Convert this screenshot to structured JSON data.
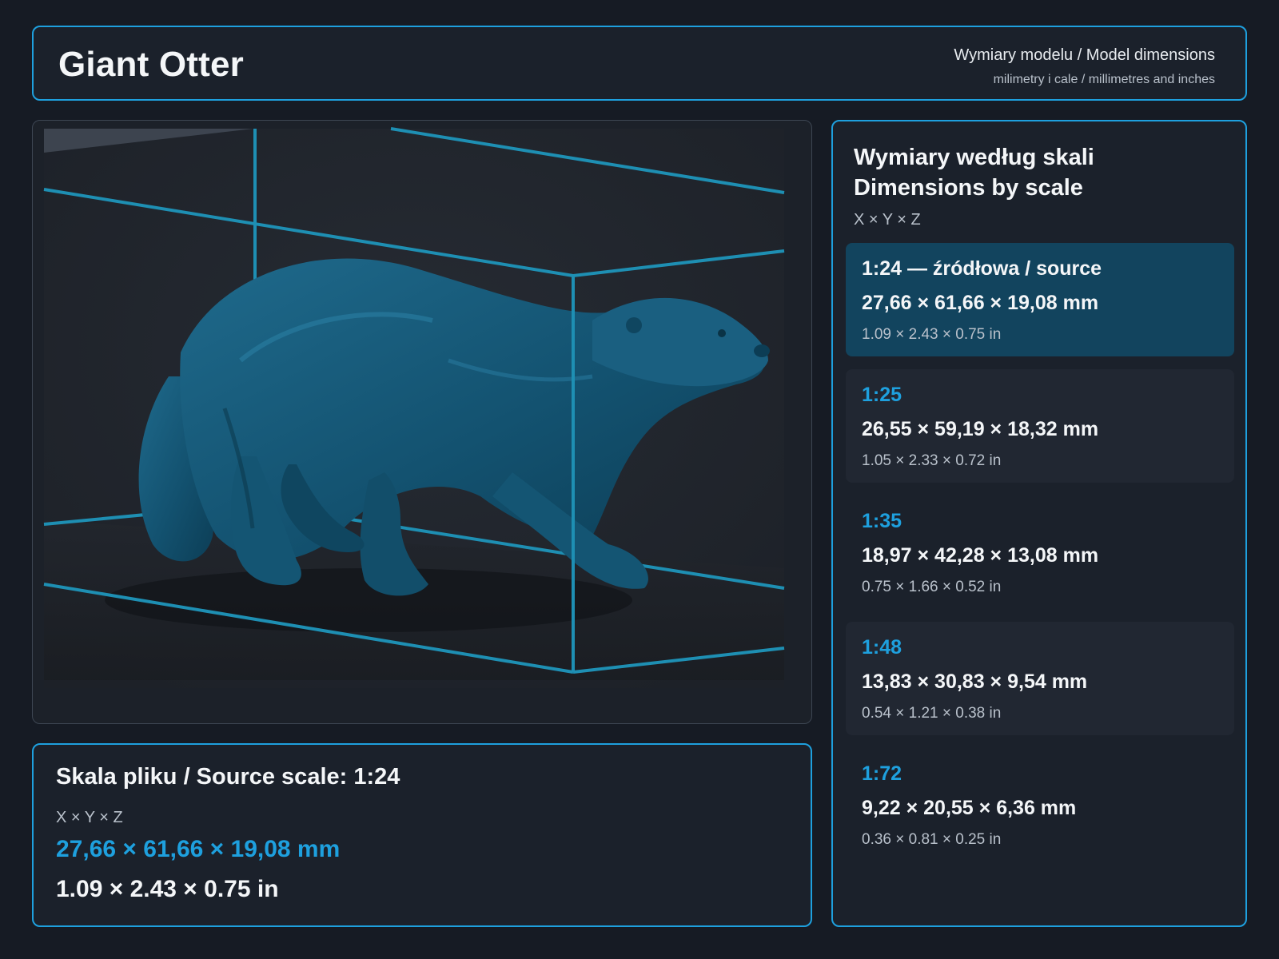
{
  "header": {
    "title": "Giant Otter",
    "subtitle": "Wymiary modelu / Model dimensions",
    "units_note": "milimetry i cale / millimetres and inches"
  },
  "viewer": {
    "model_icon": "otter-render",
    "model_color": "#135270",
    "box_color": "#1e8fb3"
  },
  "source": {
    "title": "Skala pliku / Source scale: 1:24",
    "axis_label": "X × Y × Z",
    "mm": "27,66 × 61,66 × 19,08 mm",
    "inches": "1.09 × 2.43 × 0.75 in"
  },
  "scales": {
    "title_line1": "Wymiary według skali",
    "title_line2": "Dimensions by scale",
    "axis_label": "X × Y × Z",
    "items": [
      {
        "ratio": "1:24  —  źródłowa / source",
        "mm": "27,66 × 61,66 × 19,08 mm",
        "inches": "1.09 × 2.43 × 0.75 in"
      },
      {
        "ratio": "1:25",
        "mm": "26,55 × 59,19 × 18,32 mm",
        "inches": "1.05 × 2.33 × 0.72 in"
      },
      {
        "ratio": "1:35",
        "mm": "18,97 × 42,28 × 13,08 mm",
        "inches": "0.75 × 1.66 × 0.52 in"
      },
      {
        "ratio": "1:48",
        "mm": "13,83 × 30,83 × 9,54 mm",
        "inches": "0.54 × 1.21 × 0.38 in"
      },
      {
        "ratio": "1:72",
        "mm": "9,22 × 20,55 × 6,36 mm",
        "inches": "0.36 × 0.81 × 0.25 in"
      }
    ]
  },
  "colors": {
    "accent": "#1ea0de",
    "background": "#161b24",
    "panel": "#1b212b",
    "selected_row": "#12445e"
  }
}
